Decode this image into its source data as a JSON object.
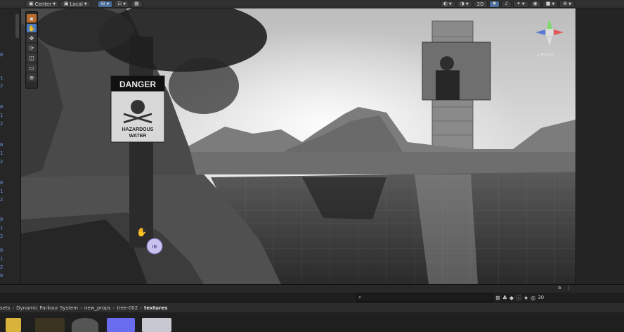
{
  "toolbar": {
    "pivot_label": "Center",
    "space_label": "Local",
    "view_2d_label": "2D",
    "icons": [
      "pivot-icon",
      "space-icon",
      "snap-icon",
      "grid-icon",
      "increment-icon",
      "draw-mode-icon",
      "2d-toggle",
      "lighting-icon",
      "audio-icon",
      "effects-icon",
      "camera-icon",
      "gizmos-icon"
    ]
  },
  "hierarchy": {
    "numbers": [
      "0",
      "1",
      "2",
      "0",
      "1",
      "2",
      "0",
      "1",
      "2",
      "0",
      "1",
      "2",
      "0",
      "1",
      "2",
      "0",
      "1",
      "2",
      "0",
      "1",
      "2"
    ]
  },
  "scene": {
    "sign_title": "DANGER",
    "sign_text_line1": "HAZARDOUS",
    "sign_text_line2": "WATER",
    "persp_label": "Persp",
    "ib_badge": "IB",
    "gizmo_axes": [
      "y",
      "x",
      "z"
    ]
  },
  "tools": [
    "view-tool",
    "move-tool",
    "rotate-tool",
    "scale-tool",
    "rect-tool",
    "transform-tool"
  ],
  "project": {
    "breadcrumb": [
      "sets",
      "Dynamic Parkour System",
      "new_props",
      "tree-002",
      "textures"
    ],
    "hidden_count": "30",
    "search_placeholder": ""
  },
  "colors": {
    "toolbar_bg": "#303030",
    "panel_bg": "#262626",
    "active_blue": "#4a7bbd",
    "number_blue": "#6d95d8"
  }
}
